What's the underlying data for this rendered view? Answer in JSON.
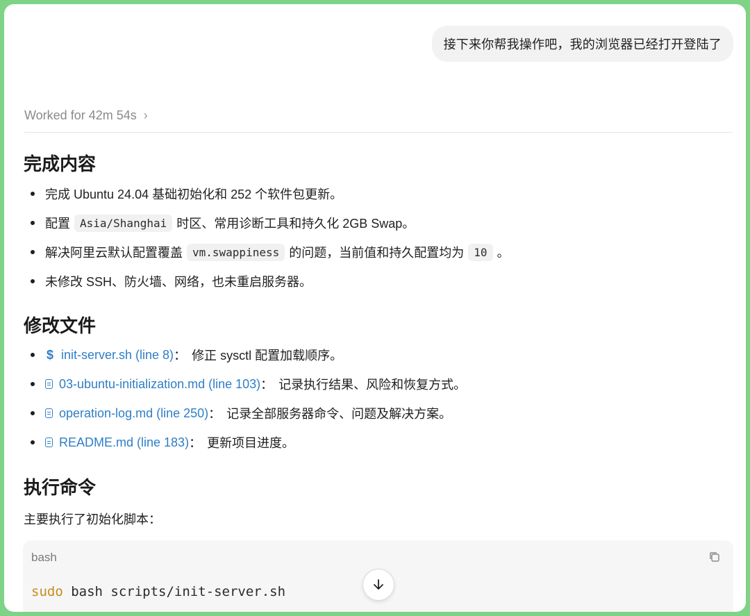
{
  "user_message": "接下来你帮我操作吧，我的浏览器已经打开登陆了",
  "worked_label": "Worked for 42m 54s",
  "sections": {
    "done": {
      "title": "完成内容",
      "items": [
        {
          "text": "完成 Ubuntu 24.04 基础初始化和 252 个软件包更新。"
        },
        {
          "pre": "配置",
          "code": "Asia/Shanghai",
          "post": "时区、常用诊断工具和持久化 2GB Swap。"
        },
        {
          "pre": "解决阿里云默认配置覆盖",
          "code": "vm.swappiness",
          "mid": "的问题，当前值和持久配置均为",
          "code2": "10",
          "post": "。"
        },
        {
          "text": "未修改 SSH、防火墙、网络，也未重启服务器。"
        }
      ]
    },
    "files": {
      "title": "修改文件",
      "items": [
        {
          "icon": "dollar-icon",
          "link": "init-server.sh (line 8)",
          "sep": "：",
          "desc": "修正 sysctl 配置加载顺序。"
        },
        {
          "icon": "file-icon",
          "link": "03-ubuntu-initialization.md (line 103)",
          "sep": "：",
          "desc": "记录执行结果、风险和恢复方式。"
        },
        {
          "icon": "file-icon",
          "link": "operation-log.md (line 250)",
          "sep": "：",
          "desc": "记录全部服务器命令、问题及解决方案。"
        },
        {
          "icon": "file-icon",
          "link": "README.md (line 183)",
          "sep": "：",
          "desc": "更新项目进度。"
        }
      ]
    },
    "commands": {
      "title": "执行命令",
      "intro": "主要执行了初始化脚本：",
      "code_lang": "bash",
      "code_kw": "sudo",
      "code_rest": " bash scripts/init-server.sh"
    }
  },
  "colors": {
    "link": "#2f7ec6",
    "keyword": "#c98a1a",
    "frame": "#7ed386"
  },
  "icons": {
    "worked_chevron": "chevron-right-icon",
    "copy": "copy-icon",
    "scroll": "arrow-down-icon"
  }
}
